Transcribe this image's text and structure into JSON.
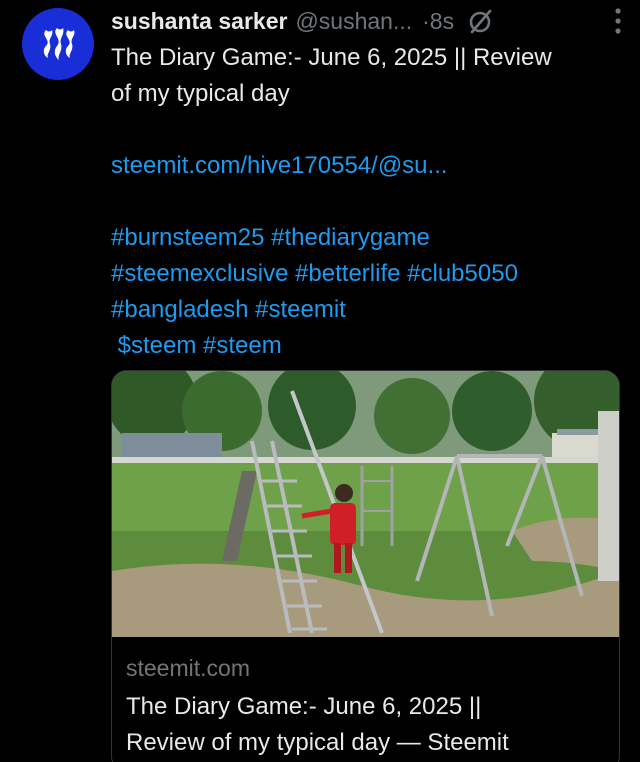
{
  "post": {
    "author_name": "sushanta sarker",
    "handle": "@sushan...",
    "time": "·8s",
    "title_line1": "The Diary Game:- June 6, 2025 || Review",
    "title_line2": "of my typical day",
    "link_text": "steemit.com/hive170554/@su...",
    "hashtag_lines": [
      "#burnsteem25 #thediarygame",
      "#steemexclusive #betterlife #club5050",
      "#bangladesh #steemit",
      " $steem #steem"
    ]
  },
  "card": {
    "domain": "steemit.com",
    "title_line1": "The Diary Game:- June 6, 2025 ||",
    "title_line2": "Review of my typical day — Steemit"
  },
  "icons": {
    "avatar": "steem-logo-icon",
    "grok": "grok-icon",
    "more": "more-options-icon"
  },
  "colors": {
    "background": "#000000",
    "text": "#e7e9ea",
    "muted": "#71767b",
    "link": "#1d9bf0",
    "avatar": "#1a2ed8"
  }
}
